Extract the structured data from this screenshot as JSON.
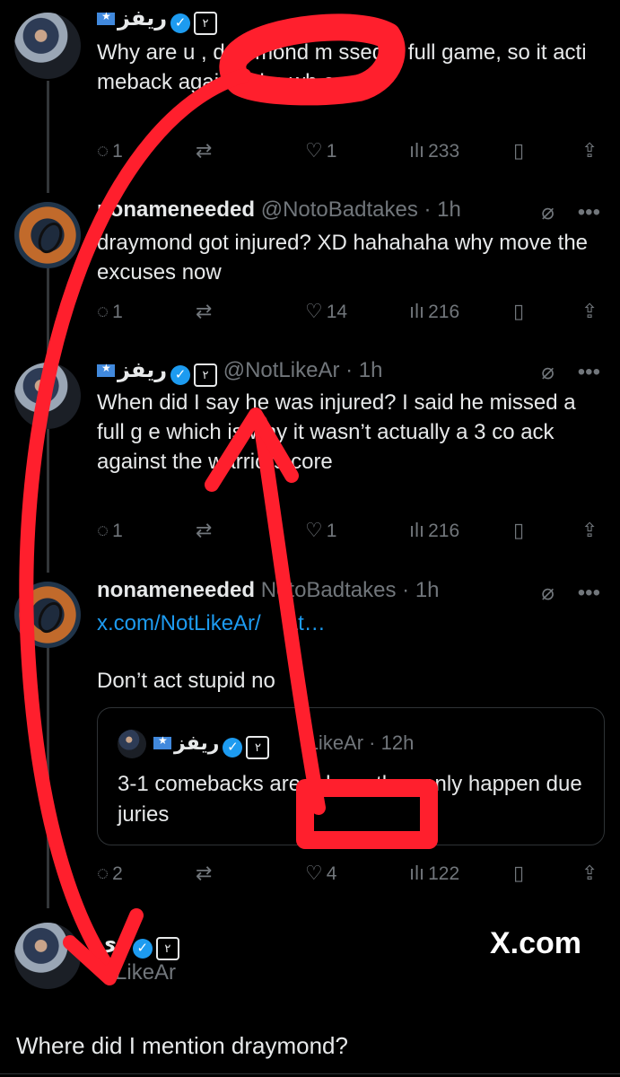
{
  "tweets": [
    {
      "name": "ريفز",
      "handle": "",
      "text_lines": [
        "Why are u",
        ", draymond",
        "ssed a full game,",
        "so it",
        "act",
        "meback against the",
        "w",
        "e core"
      ],
      "text": "Why are u    , draymond m   ssed a full game, so it    acti              meback against the wh   e core",
      "replies": "1",
      "reposts": "",
      "likes": "1",
      "views": "233"
    },
    {
      "name": "nonameneeded",
      "handle": "@NotoBadtakes",
      "time": "1h",
      "text": "draymond got injured? XD hahahaha why move the excuses now",
      "replies": "1",
      "reposts": "",
      "likes": "14",
      "views": "216"
    },
    {
      "name": "ريفز",
      "handle": "@NotLikeAr",
      "time": "1h",
      "text": "When did I say he was injured? I said he missed a full g   e which is why it wasn’t actually a 3   co   ack against the warriors core",
      "replies": "1",
      "reposts": "",
      "likes": "1",
      "views": "216"
    },
    {
      "name": "nonameneeded",
      "handle": "NotoBadtakes",
      "time": "1h",
      "link": "x.com/NotLikeAr/",
      "link_tail": "at…",
      "text": "Don’t act stupid no",
      "replies": "2",
      "reposts": "",
      "likes": "4",
      "views": "122"
    }
  ],
  "quote": {
    "name": "ريفز",
    "handle": "tLikeAr",
    "time": "12h",
    "text": "3-1 comebacks are           ed cuz they only happen due         juries"
  },
  "bottom": {
    "name": "ري",
    "handle": "otLikeAr",
    "brand": "X.com",
    "text": "Where did I mention draymond?"
  },
  "icons": {
    "reply": "reply-icon",
    "repost": "repost-icon",
    "like": "heart-icon",
    "views": "views-icon",
    "bookmark": "bookmark-icon",
    "share": "share-icon",
    "grok": "grok-icon",
    "more": "more-icon"
  },
  "colors": {
    "background": "#000000",
    "text": "#e7e9ea",
    "muted": "#71767b",
    "link": "#1d9bf0",
    "annotation": "#ff1f2d"
  }
}
